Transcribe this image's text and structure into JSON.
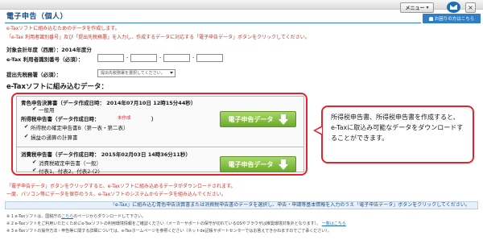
{
  "window": {
    "title": "電子申告（個人）",
    "menu_label": "メニュー",
    "menu_chevron": "▾",
    "close_glyph": "×",
    "notice_label": "お困りの方はこちら"
  },
  "intro": {
    "line1": "e-Taxソフトに組み込むためのデータを作成します。",
    "line2": "「e-Tax 利用者識別番号」及び「提出先税務署」を入力し、作成するデータに対応する「電子申告データ」ボタンをクリックしてください。"
  },
  "form": {
    "year_label": "対象会計年度（西暦）：2014年度分",
    "user_id_label": "e-Tax 利用者識別番号（必須）：",
    "user_id_separators": [
      "-",
      "-",
      "-"
    ],
    "tax_office_label": "提出先税務署（必須）：",
    "tax_office_placeholder": "提出先税務署を選択してください。"
  },
  "section": {
    "title": "e-Taxソフトに組み込むデータ："
  },
  "blue_return": {
    "header": "青色申告決算書（データ作成日時： 2014年07月10日 12時15分44秒）",
    "check_glyph": "✔",
    "item_general": "一般用",
    "income_header": "所得税申告書（データ作成日時：",
    "not_created": "未作成",
    "income_header_close": "）",
    "item_form_b": "所得税の確定申告書B（第一表・第二表）",
    "item_loss": "損益の通算の計算書",
    "button_label": "電子申告データ"
  },
  "consumption_tax": {
    "header": "消費税申告書（データ作成日時： 2015年02月03日 14時36分11秒）",
    "item_general": "消費税確定申告書（一般）",
    "item_annex": "付表1、付表2、付表2-(2)",
    "button_label": "電子申告データ"
  },
  "callout": {
    "text": "所得税申告書、所得税申告書を作成すると、e-Taxに取込み可能なデータをダウンロードすることができます。"
  },
  "notes": {
    "line1": "「電子申告データ」ボタンをクリックすると、e-Taxソフトに組み込めるデータがダウンロードされます。",
    "line2": "一度、パソコン等にデータを保存のうえ、e-Taxソフトのシステムからデータを組み込んでください。"
  },
  "banner": {
    "text": "「e-Tax」に組み込む青色申告決算書または消費税申告書のデータを選択し、申告・申請等基本情報を入力のうえ「電子申告データ」ボタンをクリックしてください。"
  },
  "footer": {
    "line1_prefix": "※ 1 e-Taxソフトは、国税庁の",
    "line1_link": "こちら",
    "line1_suffix": "のページからダウンロードして下さい。",
    "line2": "※ 2 e-Taxソフトをご利用いただくためにe-Taxソフトの利用環境情報をご確認ください（メーカーサポートの保守が切れているOSやブラウザは推奨環境対象外となります）。",
    "line2_link": "一覧はこちら",
    "line3": "※ 3 e-Taxソフトの操作方法・申告等に関する詳細については、e-Taxホームページを参照ください（ネットde記帳サポートセンターではお答えできかねますのでご了承ください）。"
  },
  "colors": {
    "accent": "#2e7fc8",
    "alert": "#e3232d",
    "button_green": "#6aaa2a"
  }
}
